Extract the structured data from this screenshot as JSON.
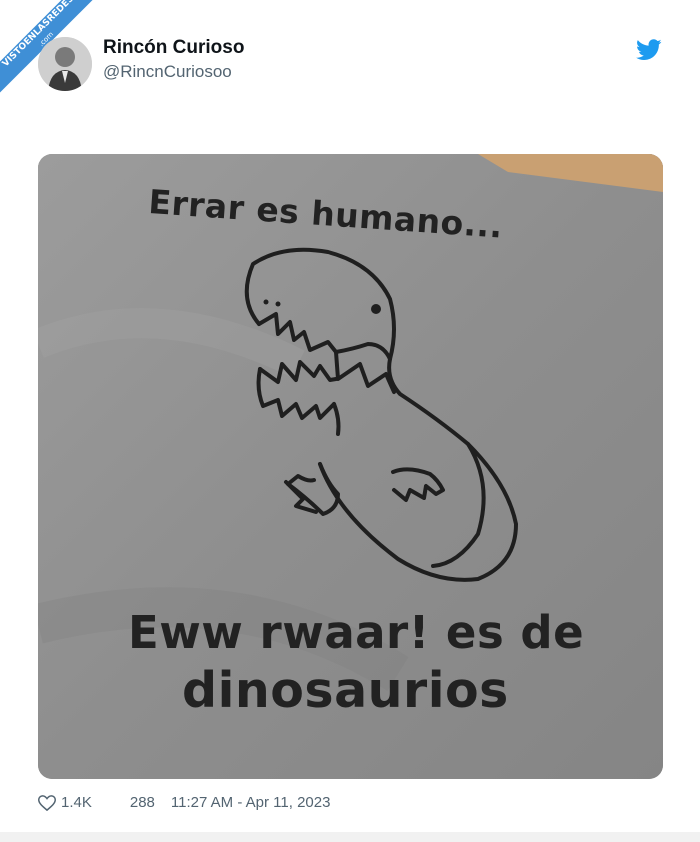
{
  "watermark": {
    "text": "VISTOENLASREDES",
    "sub": ".com"
  },
  "tweet": {
    "author_name": "Rincón Curioso",
    "author_handle": "@RincnCuriosoo",
    "image_text": {
      "top": "Errar es humano...",
      "bottom_line1": "Eww rwaar! es de",
      "bottom_line2": "dinosaurios"
    },
    "likes": "1.4K",
    "retweets": "288",
    "timestamp": "11:27 AM - Apr 11, 2023"
  },
  "icons": {
    "platform": "twitter-bird-icon",
    "like": "heart-icon"
  },
  "colors": {
    "ribbon": "#3f8fd6",
    "twitter_blue": "#1d9bf0",
    "meta_text": "#536471"
  }
}
